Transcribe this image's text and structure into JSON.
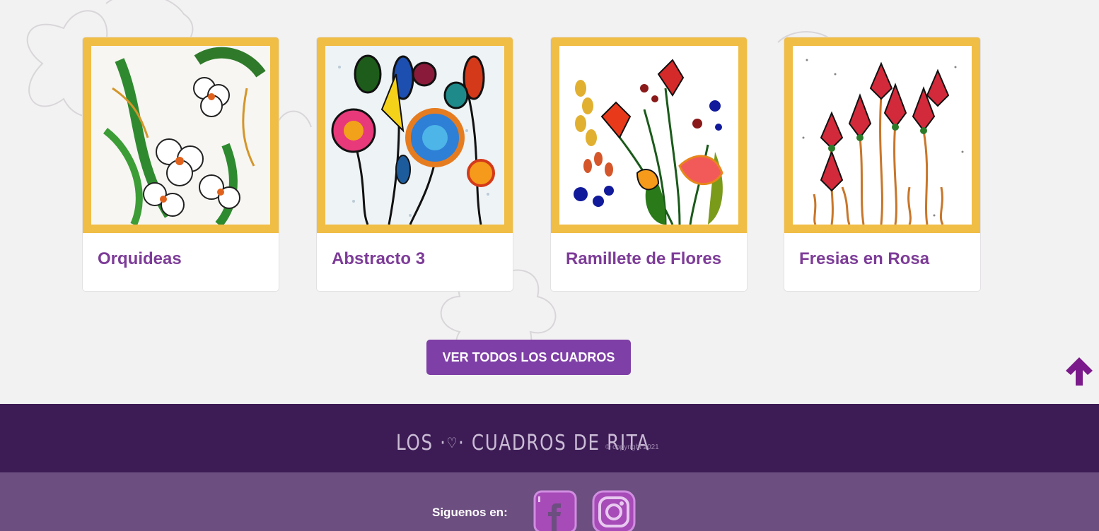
{
  "gallery": {
    "items": [
      {
        "title": "Orquideas"
      },
      {
        "title": "Abstracto 3"
      },
      {
        "title": "Ramillete de Flores"
      },
      {
        "title": "Fresias en Rosa"
      }
    ]
  },
  "cta": {
    "label": "VER TODOS LOS CUADROS"
  },
  "footer": {
    "brand_part1": "LOS ·",
    "brand_heart": "♡",
    "brand_part2": "· CUADROS DE RITA",
    "copyright": "© copyright 2021",
    "follow_label": "Siguenos en:",
    "social": [
      {
        "icon": "facebook-icon"
      },
      {
        "icon": "instagram-icon"
      }
    ]
  },
  "icons": {
    "scroll_top": "arrow-up-icon"
  },
  "colors": {
    "accent_purple": "#7e3fa6",
    "frame_gold": "#f0bd45",
    "footer_dark": "#3d1c55",
    "footer_light": "#6c4e80",
    "background": "#f3f2f3"
  }
}
